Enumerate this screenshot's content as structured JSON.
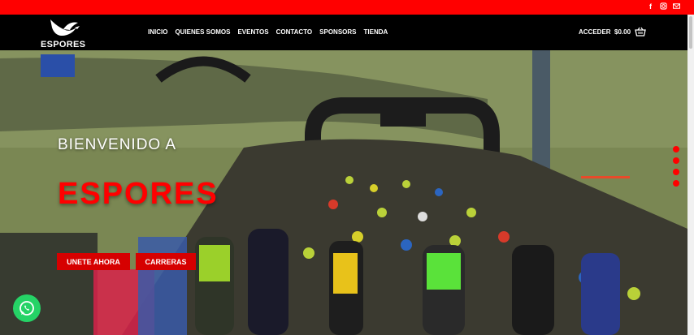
{
  "header": {
    "logo_text": "ESPORES",
    "nav": [
      "INICIO",
      "QUIENES SOMOS",
      "EVENTOS",
      "CONTACTO",
      "SPONSORS",
      "TIENDA"
    ],
    "login_label": "ACCEDER",
    "cart_total": "$0.00"
  },
  "topbar": {
    "social_icons": [
      "facebook-icon",
      "instagram-icon",
      "mail-icon"
    ]
  },
  "hero": {
    "welcome": "BIENVENIDO A",
    "brand": "ESPORES",
    "buttons": [
      "UNETE AHORA",
      "CARRERAS"
    ],
    "slider_dots": 4
  },
  "colors": {
    "accent": "#ff0000",
    "button": "#d60000",
    "navbar": "#000000",
    "whatsapp": "#25d366"
  }
}
